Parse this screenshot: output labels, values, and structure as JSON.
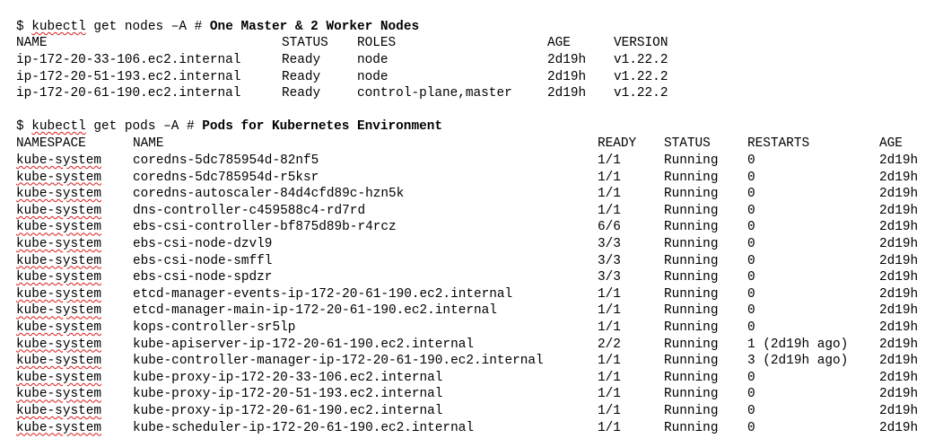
{
  "nodes_section": {
    "prompt": "$ ",
    "command": "kubectl",
    "args": " get nodes –A # ",
    "comment": "One Master & 2 Worker Nodes",
    "headers": [
      "NAME",
      "STATUS",
      "ROLES",
      "AGE",
      "VERSION"
    ],
    "rows": [
      [
        "ip-172-20-33-106.ec2.internal",
        "Ready",
        "node",
        "2d19h",
        "v1.22.2"
      ],
      [
        "ip-172-20-51-193.ec2.internal",
        "Ready",
        "node",
        "2d19h",
        "v1.22.2"
      ],
      [
        "ip-172-20-61-190.ec2.internal",
        "Ready",
        "control-plane,master",
        "2d19h",
        "v1.22.2"
      ]
    ]
  },
  "pods_section": {
    "prompt": "$ ",
    "command": "kubectl",
    "args": " get pods –A # ",
    "comment": "Pods for Kubernetes Environment",
    "headers": [
      "NAMESPACE",
      "NAME",
      "READY",
      "STATUS",
      "RESTARTS",
      "AGE"
    ],
    "rows": [
      [
        "kube-system",
        "coredns-5dc785954d-82nf5",
        "1/1",
        "Running",
        "0",
        "2d19h"
      ],
      [
        "kube-system",
        "coredns-5dc785954d-r5ksr",
        "1/1",
        "Running",
        "0",
        "2d19h"
      ],
      [
        "kube-system",
        "coredns-autoscaler-84d4cfd89c-hzn5k",
        "1/1",
        "Running",
        "0",
        "2d19h"
      ],
      [
        "kube-system",
        "dns-controller-c459588c4-rd7rd",
        "1/1",
        "Running",
        "0",
        "2d19h"
      ],
      [
        "kube-system",
        "ebs-csi-controller-bf875d89b-r4rcz",
        "6/6",
        "Running",
        "0",
        "2d19h"
      ],
      [
        "kube-system",
        "ebs-csi-node-dzvl9",
        "3/3",
        "Running",
        "0",
        "2d19h"
      ],
      [
        "kube-system",
        "ebs-csi-node-smffl",
        "3/3",
        "Running",
        "0",
        "2d19h"
      ],
      [
        "kube-system",
        "ebs-csi-node-spdzr",
        "3/3",
        "Running",
        "0",
        "2d19h"
      ],
      [
        "kube-system",
        "etcd-manager-events-ip-172-20-61-190.ec2.internal",
        "1/1",
        "Running",
        "0",
        "2d19h"
      ],
      [
        "kube-system",
        "etcd-manager-main-ip-172-20-61-190.ec2.internal",
        "1/1",
        "Running",
        "0",
        "2d19h"
      ],
      [
        "kube-system",
        "kops-controller-sr5lp",
        "1/1",
        "Running",
        "0",
        "2d19h"
      ],
      [
        "kube-system",
        "kube-apiserver-ip-172-20-61-190.ec2.internal",
        "2/2",
        "Running",
        "1 (2d19h ago)",
        "2d19h"
      ],
      [
        "kube-system",
        "kube-controller-manager-ip-172-20-61-190.ec2.internal",
        "1/1",
        "Running",
        "3 (2d19h ago)",
        "2d19h"
      ],
      [
        "kube-system",
        "kube-proxy-ip-172-20-33-106.ec2.internal",
        "1/1",
        "Running",
        "0",
        "2d19h"
      ],
      [
        "kube-system",
        "kube-proxy-ip-172-20-51-193.ec2.internal",
        "1/1",
        "Running",
        "0",
        "2d19h"
      ],
      [
        "kube-system",
        "kube-proxy-ip-172-20-61-190.ec2.internal",
        "1/1",
        "Running",
        "0",
        "2d19h"
      ],
      [
        "kube-system",
        "kube-scheduler-ip-172-20-61-190.ec2.internal",
        "1/1",
        "Running",
        "0",
        "2d19h"
      ]
    ]
  }
}
